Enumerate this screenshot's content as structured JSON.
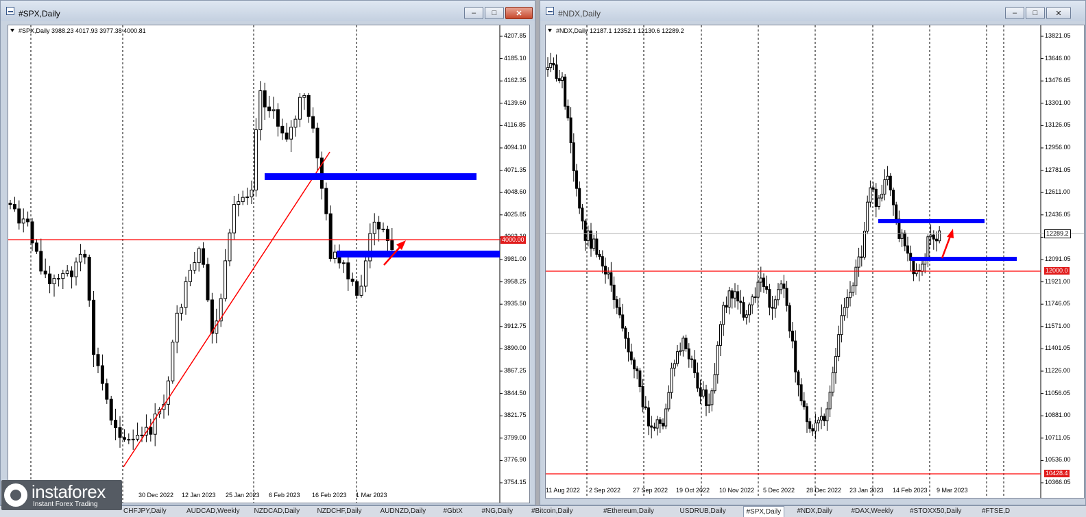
{
  "windows": {
    "spx": {
      "title": "#SPX,Daily",
      "info": "#SPX,Daily  3988.23 4017.93 3977.38 4000.81",
      "price_labels": [
        "4207.85",
        "4185.10",
        "4162.35",
        "4139.60",
        "4116.85",
        "4094.10",
        "4071.35",
        "4048.60",
        "4025.85",
        "4003.10",
        "3981.00",
        "3958.25",
        "3935.50",
        "3912.75",
        "3890.00",
        "3867.25",
        "3844.50",
        "3821.75",
        "3799.00",
        "3776.90",
        "3754.15"
      ],
      "current_price_badge": "4000.00",
      "date_labels": [
        "30 Dec 2022",
        "12 Jan 2023",
        "25 Jan 2023",
        "6 Feb 2023",
        "16 Feb 2023",
        "1 Mar 2023"
      ]
    },
    "ndx": {
      "title": "#NDX,Daily",
      "info": "#NDX,Daily  12187.1 12352.1 12130.6 12289.2",
      "price_labels": [
        "13821.05",
        "13646.00",
        "13476.05",
        "13301.00",
        "13126.05",
        "12956.00",
        "12781.05",
        "12611.00",
        "12436.05",
        "12261.00",
        "12091.05",
        "11921.00",
        "11746.05",
        "11571.00",
        "11401.05",
        "11226.00",
        "11056.05",
        "10881.00",
        "10711.05",
        "10536.00",
        "10366.05"
      ],
      "current_price_badge": "12289.2",
      "level_badge_1": "12000.0",
      "level_badge_2": "10428.4",
      "date_labels": [
        "11 Aug 2022",
        "2 Sep 2022",
        "27 Sep 2022",
        "19 Oct 2022",
        "10 Nov 2022",
        "5 Dec 2022",
        "28 Dec 2022",
        "23 Jan 2023",
        "14 Feb 2023",
        "9 Mar 2023"
      ]
    }
  },
  "window_controls": {
    "minimize": "–",
    "maximize": "□",
    "close": "✕"
  },
  "tabs": [
    "CHFJPY,Daily",
    "AUDCAD,Weekly",
    "NZDCAD,Daily",
    "NZDCHF,Daily",
    "AUDNZD,Daily",
    "#GbtX",
    "#NG,Daily",
    "#Bitcoin,Daily",
    "#Ethereum,Daily",
    "USDRUB,Daily",
    "#SPX,Daily",
    "#NDX,Daily",
    "#DAX,Weekly",
    "#STOXX50,Daily",
    "#FTSE,D"
  ],
  "active_tab": "#SPX,Daily",
  "logo": {
    "name": "instaforex",
    "tagline": "Instant Forex Trading"
  },
  "chart_data": [
    {
      "type": "candlestick",
      "title": "#SPX,Daily",
      "ylim": [
        3754.15,
        4207.85
      ],
      "x": [
        "30 Dec 2022",
        "12 Jan 2023",
        "25 Jan 2023",
        "6 Feb 2023",
        "16 Feb 2023",
        "1 Mar 2023"
      ],
      "last_ohlc": {
        "open": 3988.23,
        "high": 4017.93,
        "low": 3977.38,
        "close": 4000.81
      },
      "levels": [
        4000.0,
        4070,
        3985
      ],
      "annotations": [
        "red rising trendline",
        "blue resistance zone",
        "blue support zone",
        "red arrow up"
      ]
    },
    {
      "type": "candlestick",
      "title": "#NDX,Daily",
      "ylim": [
        10366.05,
        13821.05
      ],
      "x": [
        "11 Aug 2022",
        "2 Sep 2022",
        "27 Sep 2022",
        "19 Oct 2022",
        "10 Nov 2022",
        "5 Dec 2022",
        "28 Dec 2022",
        "23 Jan 2023",
        "14 Feb 2023",
        "9 Mar 2023"
      ],
      "last_ohlc": {
        "open": 12187.1,
        "high": 12352.1,
        "low": 12130.6,
        "close": 12289.2
      },
      "levels": [
        12000.0,
        10428.4,
        12380,
        12100
      ],
      "annotations": [
        "blue resistance zone",
        "blue support zone",
        "red arrow up"
      ]
    }
  ]
}
